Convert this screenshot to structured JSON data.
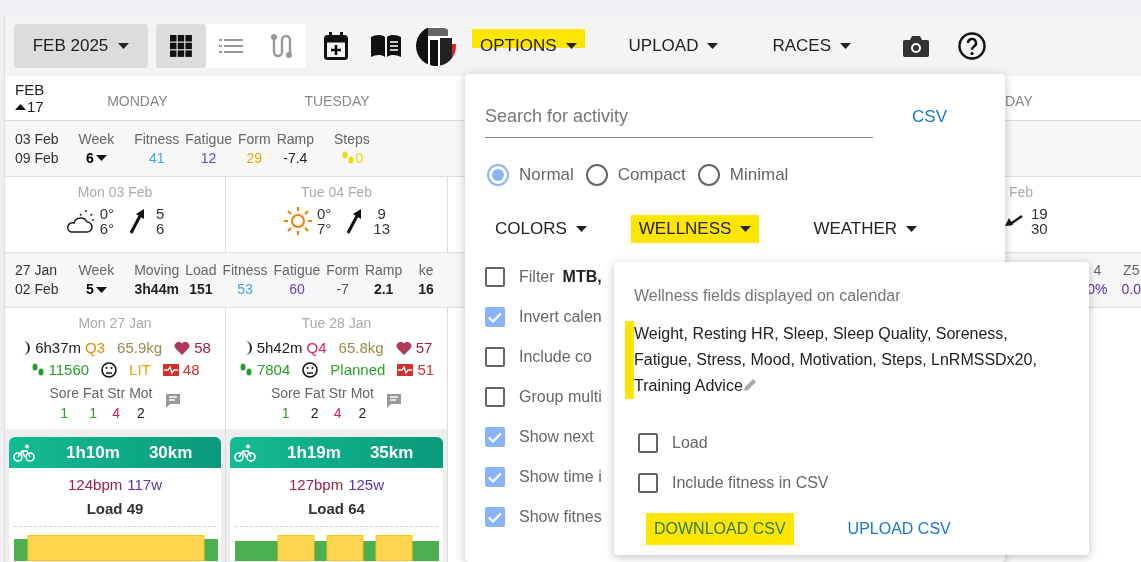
{
  "toolbar": {
    "month": "FEB 2025",
    "views": [
      {
        "kind": "grid",
        "selected": true
      },
      {
        "kind": "list",
        "selected": false
      },
      {
        "kind": "route",
        "selected": false
      }
    ],
    "menus": [
      {
        "label": "OPTIONS",
        "highlighted": true
      },
      {
        "label": "UPLOAD",
        "highlighted": false
      },
      {
        "label": "RACES",
        "highlighted": false
      }
    ]
  },
  "calendar": {
    "corner": {
      "month": "FEB",
      "week": "17"
    },
    "day_headers": [
      "MONDAY",
      "TUESDAY"
    ],
    "cut_header": "DAY",
    "weeks": [
      {
        "start": "03 Feb",
        "end": "09 Feb",
        "week_label": "Week",
        "week": "6",
        "stats": [
          {
            "kind": "plain",
            "label": "Fitness",
            "value": "41",
            "color": "#3ba6e6"
          },
          {
            "kind": "plain",
            "label": "Fatigue",
            "value": "12",
            "color": "#6b3fd4"
          },
          {
            "kind": "plain",
            "label": "Form",
            "value": "29",
            "color": "#e6a800"
          },
          {
            "kind": "plain",
            "label": "Ramp",
            "value": "-7.4",
            "color": "#222222"
          },
          {
            "kind": "steps",
            "label": "Steps",
            "value": "0",
            "color": "#e8dc00"
          }
        ],
        "days": [
          {
            "kind": "weather",
            "date": "Mon 03 Feb",
            "sky": {
              "kind": "cloudy"
            },
            "low": "0°",
            "high": "6°",
            "wind": "5",
            "gust": "6"
          },
          {
            "kind": "weather",
            "date": "Tue 04 Feb",
            "sky": {
              "kind": "sunny"
            },
            "low": "0°",
            "high": "7°",
            "wind": "9",
            "gust": "13"
          }
        ],
        "cut_day": {
          "date": "Feb",
          "wind": "19",
          "gust": "30"
        }
      },
      {
        "start": "27 Jan",
        "end": "02 Feb",
        "week_label": "Week",
        "week": "5",
        "stats": [
          {
            "kind": "bold",
            "label": "Moving",
            "value": "3h44m",
            "color": "#222222"
          },
          {
            "kind": "bold",
            "label": "Load",
            "value": "151",
            "color": "#222222"
          },
          {
            "kind": "plain",
            "label": "Fitness",
            "value": "53",
            "color": "#3ba6e6"
          },
          {
            "kind": "plain",
            "label": "Fatigue",
            "value": "60",
            "color": "#6b3fd4"
          },
          {
            "kind": "plain",
            "label": "Form",
            "value": "-7",
            "color": "#555555"
          },
          {
            "kind": "bold",
            "label": "Ramp",
            "value": "2.1",
            "color": "#222222"
          },
          {
            "kind": "bold",
            "label": "ke",
            "value": "16",
            "color": "#222222"
          }
        ],
        "cut_stats": [
          {
            "label": "4",
            "value": "0%",
            "color": "#5b2fb0"
          },
          {
            "label": "Z5",
            "value": "0.0",
            "color": "#5b2fb0"
          }
        ],
        "days": [
          {
            "kind": "wellness",
            "date": "Mon 27 Jan",
            "sleep": "6h37m",
            "quality": {
              "text": "Q3",
              "color": "#f08a00"
            },
            "weight": "65.9kg",
            "resting_hr": "58",
            "steps": "11560",
            "advice": {
              "text": "LIT",
              "color": "#f5a000"
            },
            "hrv": "48",
            "scores": [
              {
                "label": "Sore",
                "value": "1",
                "color": "#2a9d2a"
              },
              {
                "label": "Fat",
                "value": "1",
                "color": "#2a9d2a"
              },
              {
                "label": "Str",
                "value": "4",
                "color": "#e0205a"
              },
              {
                "label": "Mot",
                "value": "2",
                "color": "#222222"
              }
            ],
            "activity": {
              "duration": "1h10m",
              "distance": "30km",
              "hr": "124bpm",
              "power": "117w",
              "load": "Load 49",
              "profile": {
                "kind": "steady"
              }
            }
          },
          {
            "kind": "wellness",
            "date": "Tue 28 Jan",
            "sleep": "5h42m",
            "quality": {
              "text": "Q4",
              "color": "#e0205a"
            },
            "weight": "65.8kg",
            "resting_hr": "57",
            "steps": "7804",
            "advice": {
              "text": "Planned",
              "color": "#2aa52a"
            },
            "hrv": "51",
            "scores": [
              {
                "label": "Sore",
                "value": "1",
                "color": "#2a9d2a"
              },
              {
                "label": "Fat",
                "value": "2",
                "color": "#222222"
              },
              {
                "label": "Str",
                "value": "4",
                "color": "#e0205a"
              },
              {
                "label": "Mot",
                "value": "2",
                "color": "#222222"
              }
            ],
            "activity": {
              "duration": "1h19m",
              "distance": "35km",
              "hr": "127bpm",
              "power": "125w",
              "load": "Load 64",
              "profile": {
                "kind": "intervals"
              }
            }
          }
        ]
      }
    ]
  },
  "options_menu": {
    "placeholder": "Search for activity",
    "csv_link": "CSV",
    "layouts": [
      {
        "label": "Normal",
        "selected": true
      },
      {
        "label": "Compact",
        "selected": false
      },
      {
        "label": "Minimal",
        "selected": false
      }
    ],
    "dropdowns": [
      {
        "label": "COLORS",
        "highlighted": false
      },
      {
        "label": "WELLNESS",
        "highlighted": true
      },
      {
        "label": "WEATHER",
        "highlighted": false
      }
    ],
    "settings": [
      {
        "label": "Filter",
        "value": "MTB,",
        "checked": false
      },
      {
        "label": "Invert calen",
        "checked": true
      },
      {
        "label": "Include co",
        "checked": false
      },
      {
        "label": "Group multi",
        "checked": false
      },
      {
        "label": "Show next",
        "checked": true
      },
      {
        "label": "Show time i",
        "checked": true
      },
      {
        "label": "Show fitnes",
        "checked": true
      }
    ]
  },
  "wellness_menu": {
    "heading": "Wellness fields displayed on calendar",
    "fields": {
      "text": "Weight, Resting HR, Sleep, Sleep Quality, Soreness, Fatigue, Stress, Mood, Motivation, Steps, LnRMSSDx20, Training Advice",
      "highlighted": true
    },
    "options": [
      {
        "label": "Load",
        "checked": false
      },
      {
        "label": "Include fitness in CSV",
        "checked": false
      }
    ],
    "buttons": [
      {
        "label": "DOWNLOAD CSV",
        "kind": "download",
        "highlighted": true
      },
      {
        "label": "UPLOAD CSV",
        "kind": "upload",
        "highlighted": false
      }
    ]
  }
}
